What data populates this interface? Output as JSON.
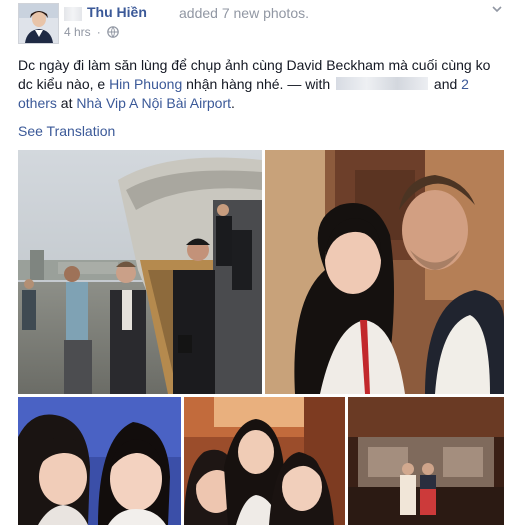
{
  "post": {
    "author": "Thu Hiền",
    "action": "added 7 new photos.",
    "time": "4 hrs",
    "text_before": "Dc ngày đi làm săn lùng để chụp ảnh cùng David Beckham mà cuối cùng ko dc kiểu nào, e ",
    "mention": "Hin Phuong",
    "text_after": " nhận hàng nhé. — with ",
    "and_text": " and ",
    "others": "2 others",
    "at_text": " at ",
    "location": "Nhà Vip A Nội Bài Airport",
    "period": ".",
    "see_translation": "See Translation"
  },
  "icons": {
    "audience": "globe-icon",
    "menu": "chevron-down-icon"
  },
  "colors": {
    "link": "#3b5998",
    "meta": "#9197a3",
    "text": "#141823"
  }
}
